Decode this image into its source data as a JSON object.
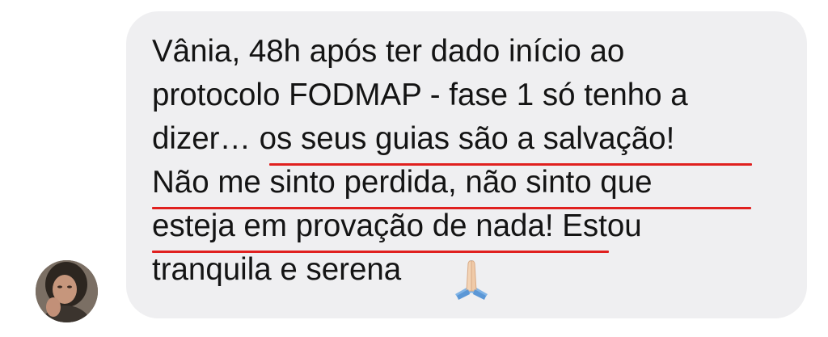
{
  "message": {
    "lines": [
      "Vânia, 48h após ter dado início ao",
      "protocolo FODMAP - fase 1 só tenho a",
      "dizer… os seus guias são a salvação!",
      "Não me sinto perdida, não sinto que",
      "esteja em provação de nada! Estou",
      "tranquila e serena"
    ],
    "emoji": "folded-hands-emoji",
    "underline_color": "#e0201f",
    "bubble_color": "#efeff1",
    "text_color": "#141414"
  },
  "sender": {
    "avatar": "avatar"
  }
}
